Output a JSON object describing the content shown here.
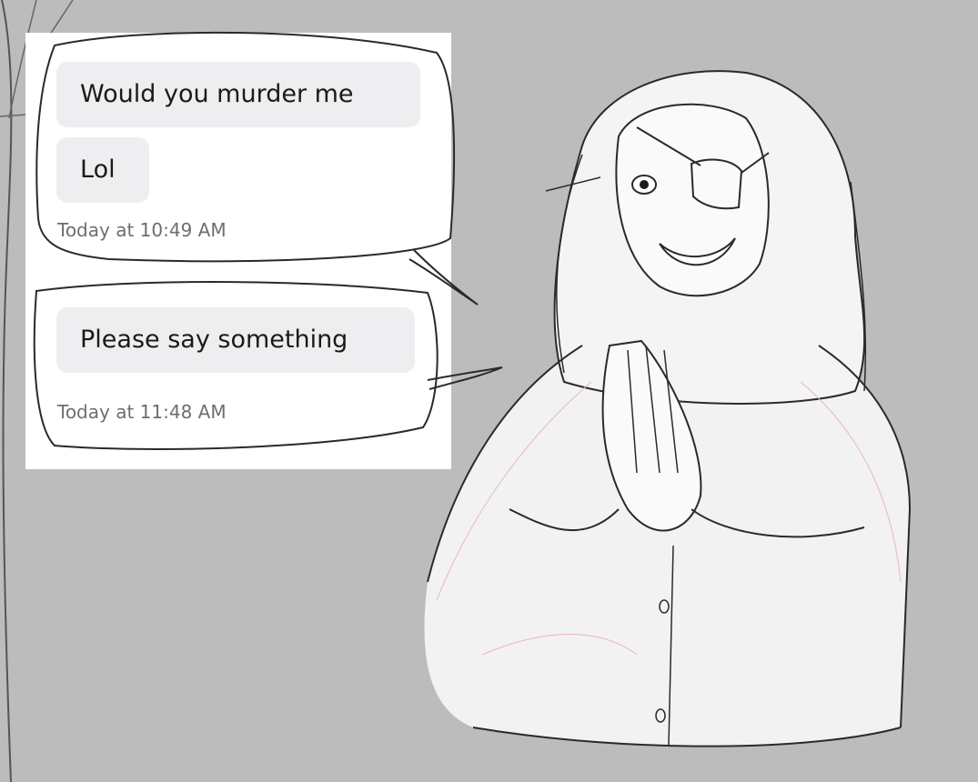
{
  "messages": [
    {
      "text": "Would you murder me"
    },
    {
      "text": "Lol"
    },
    {
      "text": "Please say something"
    }
  ],
  "timestamps": [
    "Today at 10:49 AM",
    "Today at 11:48 AM"
  ],
  "colors": {
    "background": "#bcbcbc",
    "bubble": "#eeeef0",
    "panel": "#ffffff",
    "sketch_line": "#2a2a2a",
    "sketch_red": "#e8b8b8"
  }
}
